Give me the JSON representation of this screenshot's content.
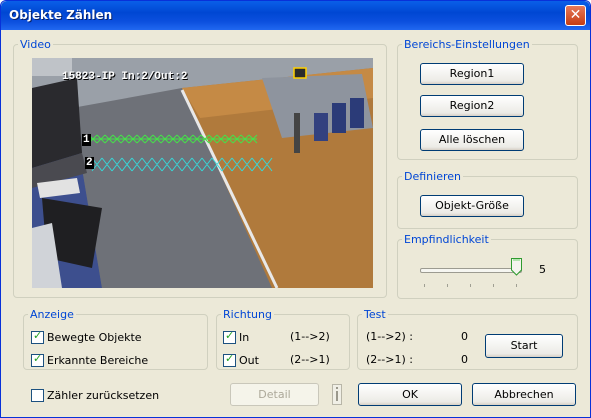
{
  "window": {
    "title": "Objekte Zählen",
    "close": "✕"
  },
  "video": {
    "group_label": "Video",
    "camera_label": "15823-IP In:2/Out:2",
    "zones": [
      "1",
      "2"
    ]
  },
  "region_settings": {
    "group_label": "Bereichs-Einstellungen",
    "region1": "Region1",
    "region2": "Region2",
    "clear_all": "Alle löschen"
  },
  "define": {
    "group_label": "Definieren",
    "object_size": "Objekt-Größe"
  },
  "sensitivity": {
    "group_label": "Empfindlichkeit",
    "value": "5",
    "level_fraction": 0.88
  },
  "display": {
    "group_label": "Anzeige",
    "moving_objects": "Bewegte Objekte",
    "moving_objects_checked": true,
    "detected_areas": "Erkannte Bereiche",
    "detected_areas_checked": true
  },
  "direction": {
    "group_label": "Richtung",
    "in_label": "In",
    "in_arrow": "(1-->2)",
    "in_checked": true,
    "out_label": "Out",
    "out_arrow": "(2-->1)",
    "out_checked": true
  },
  "test": {
    "group_label": "Test",
    "row1_label": "(1-->2) :",
    "row1_value": "0",
    "row2_label": "(2-->1) :",
    "row2_value": "0",
    "start": "Start"
  },
  "footer": {
    "reset_counter": "Zähler zurücksetzen",
    "reset_checked": false,
    "detail": "Detail",
    "ok": "OK",
    "cancel": "Abbrechen"
  },
  "colors": {
    "titlebar": "#0047d3",
    "group_label": "#0046d5",
    "zone1": "#46e04a",
    "zone2": "#36d8d8",
    "check": "#21a121"
  }
}
